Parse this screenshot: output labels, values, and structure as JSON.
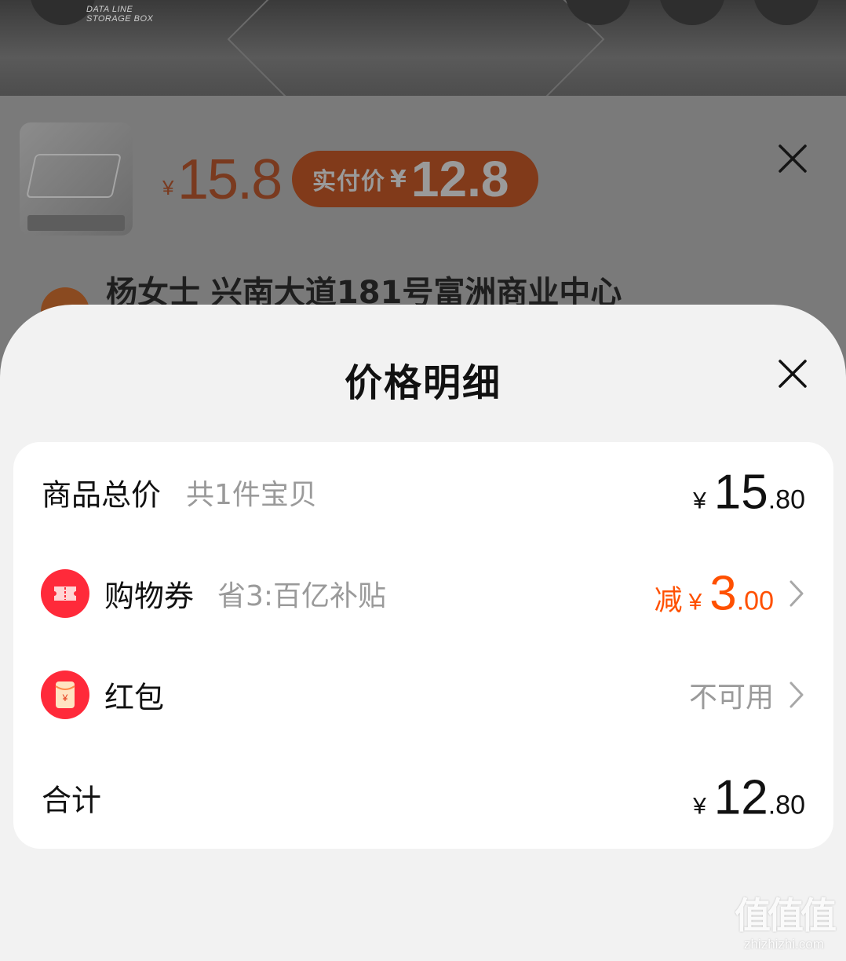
{
  "background": {
    "banner_caption_line1": "DATA LINE",
    "banner_caption_line2": "STORAGE BOX",
    "price_currency": "¥",
    "price": "15.8",
    "paid_label": "实付价",
    "paid_currency": "¥",
    "paid_price": "12.8",
    "address": "杨女士 兴南大道181号富洲商业中心",
    "close_icon": "close-icon"
  },
  "sheet": {
    "title": "价格明细",
    "close_icon": "close-icon",
    "rows": {
      "total": {
        "label": "商品总价",
        "sub": "共1件宝贝",
        "currency": "¥",
        "int": "15",
        "dec": ".80"
      },
      "coupon": {
        "icon": "ticket-icon",
        "icon_color": "#ff2a3a",
        "label": "购物券",
        "sub": "省3:百亿补贴",
        "prefix": "减",
        "currency": "¥",
        "int": "3",
        "dec": ".00",
        "accent": "#ff5000"
      },
      "redpacket": {
        "icon": "red-envelope-icon",
        "icon_color": "#ff2a3a",
        "label": "红包",
        "status": "不可用"
      },
      "sum": {
        "label": "合计",
        "currency": "¥",
        "int": "12",
        "dec": ".80"
      }
    }
  },
  "watermark": {
    "main": "值值值",
    "sub": "zhizhizhi.com"
  }
}
